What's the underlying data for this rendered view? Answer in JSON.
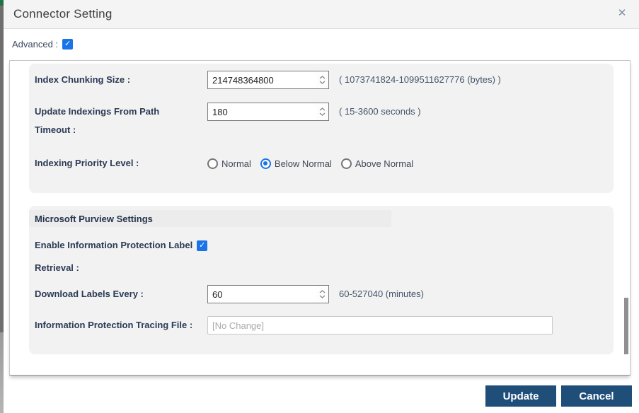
{
  "dialog": {
    "title": "Connector Setting",
    "close_glyph": "✕"
  },
  "advanced": {
    "label": "Advanced :",
    "checked": true
  },
  "colors": {
    "accent_blue": "#1a73e8",
    "button_navy": "#1f4e79",
    "label_navy": "#2b3a55",
    "panel_bg": "#f2f2f2"
  },
  "panels": {
    "indexing": {
      "chunking": {
        "label": "Index Chunking Size :",
        "value": "214748364800",
        "hint": "( 1073741824-1099511627776 (bytes) )"
      },
      "timeout": {
        "label_line1": "Update Indexings From Path",
        "label_line2": "Timeout :",
        "value": "180",
        "hint": "( 15-3600 seconds )"
      },
      "priority": {
        "label": "Indexing Priority Level :",
        "options": [
          {
            "label": "Normal",
            "selected": false
          },
          {
            "label": "Below Normal",
            "selected": true
          },
          {
            "label": "Above Normal",
            "selected": false
          }
        ]
      }
    },
    "purview": {
      "title": "Microsoft Purview Settings",
      "enable": {
        "label_line1": "Enable Information Protection Label",
        "label_line2": "Retrieval :",
        "checked": true
      },
      "download": {
        "label": "Download Labels Every :",
        "value": "60",
        "hint": "60-527040 (minutes)"
      },
      "tracing": {
        "label": "Information Protection Tracing File :",
        "placeholder": "[No Change]"
      }
    }
  },
  "footer": {
    "update_label": "Update",
    "cancel_label": "Cancel"
  }
}
